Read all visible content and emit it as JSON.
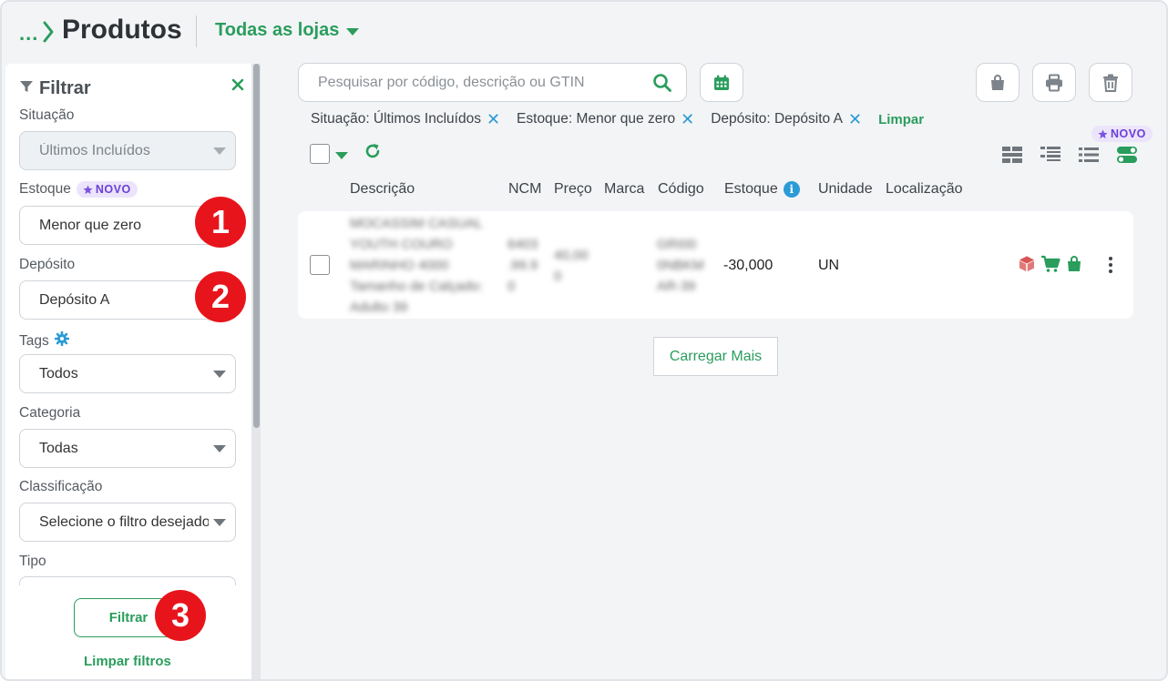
{
  "header": {
    "breadcrumb_dots": "...",
    "title": "Produtos",
    "store_selector": "Todas as lojas"
  },
  "sidebar": {
    "title": "Filtrar",
    "situacao": {
      "label": "Situação",
      "value": "Últimos Incluídos"
    },
    "estoque": {
      "label": "Estoque",
      "badge": "NOVO",
      "value": "Menor que zero"
    },
    "deposito": {
      "label": "Depósito",
      "value": "Depósito A"
    },
    "tags": {
      "label": "Tags",
      "value": "Todos"
    },
    "categoria": {
      "label": "Categoria",
      "value": "Todas"
    },
    "classificacao": {
      "label": "Classificação",
      "value": "Selecione o filtro desejado"
    },
    "tipo": {
      "label": "Tipo"
    },
    "filter_button": "Filtrar",
    "clear_filters": "Limpar filtros"
  },
  "steps": [
    "1",
    "2",
    "3"
  ],
  "search": {
    "placeholder": "Pesquisar por código, descrição ou GTIN"
  },
  "active_filters": [
    {
      "text": "Situação: Últimos Incluídos",
      "remove": "✕"
    },
    {
      "text": "Estoque: Menor que zero",
      "remove": "✕"
    },
    {
      "text": "Depósito: Depósito A",
      "remove": "✕"
    }
  ],
  "clear_chips": "Limpar",
  "new_badge": "NOVO",
  "columns": [
    "Descrição",
    "NCM",
    "Preço",
    "Marca",
    "Código",
    "Estoque",
    "Unidade",
    "Localização"
  ],
  "rows": [
    {
      "descricao": [
        "MOCASSIM CASUAL",
        "YOUTH COURO",
        "MARINHO 4000",
        "Tamanho de Calçado:",
        "Adulto 39"
      ],
      "ncm": [
        "6403",
        ".99.9",
        "0"
      ],
      "preco": [
        "40,00",
        "0"
      ],
      "codigo": [
        "GRI00",
        "0NBKM",
        "AR-39"
      ],
      "estoque": "-30,000",
      "unidade": "UN"
    }
  ],
  "load_more": "Carregar Mais",
  "colors": {
    "brand_green": "#2a9d5c",
    "info_blue": "#2b9bd6",
    "step_red": "#e8141c",
    "novo_purple": "#6b3fd6"
  }
}
